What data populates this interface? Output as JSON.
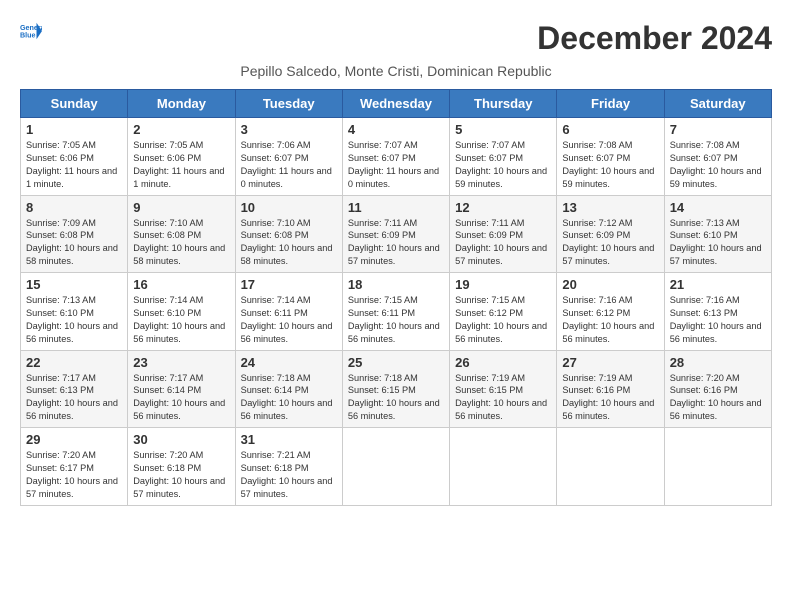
{
  "header": {
    "logo_line1": "General",
    "logo_line2": "Blue",
    "title": "December 2024",
    "subtitle": "Pepillo Salcedo, Monte Cristi, Dominican Republic"
  },
  "days_of_week": [
    "Sunday",
    "Monday",
    "Tuesday",
    "Wednesday",
    "Thursday",
    "Friday",
    "Saturday"
  ],
  "weeks": [
    [
      {
        "day": "1",
        "sunrise": "Sunrise: 7:05 AM",
        "sunset": "Sunset: 6:06 PM",
        "daylight": "Daylight: 11 hours and 1 minute."
      },
      {
        "day": "2",
        "sunrise": "Sunrise: 7:05 AM",
        "sunset": "Sunset: 6:06 PM",
        "daylight": "Daylight: 11 hours and 1 minute."
      },
      {
        "day": "3",
        "sunrise": "Sunrise: 7:06 AM",
        "sunset": "Sunset: 6:07 PM",
        "daylight": "Daylight: 11 hours and 0 minutes."
      },
      {
        "day": "4",
        "sunrise": "Sunrise: 7:07 AM",
        "sunset": "Sunset: 6:07 PM",
        "daylight": "Daylight: 11 hours and 0 minutes."
      },
      {
        "day": "5",
        "sunrise": "Sunrise: 7:07 AM",
        "sunset": "Sunset: 6:07 PM",
        "daylight": "Daylight: 10 hours and 59 minutes."
      },
      {
        "day": "6",
        "sunrise": "Sunrise: 7:08 AM",
        "sunset": "Sunset: 6:07 PM",
        "daylight": "Daylight: 10 hours and 59 minutes."
      },
      {
        "day": "7",
        "sunrise": "Sunrise: 7:08 AM",
        "sunset": "Sunset: 6:07 PM",
        "daylight": "Daylight: 10 hours and 59 minutes."
      }
    ],
    [
      {
        "day": "8",
        "sunrise": "Sunrise: 7:09 AM",
        "sunset": "Sunset: 6:08 PM",
        "daylight": "Daylight: 10 hours and 58 minutes."
      },
      {
        "day": "9",
        "sunrise": "Sunrise: 7:10 AM",
        "sunset": "Sunset: 6:08 PM",
        "daylight": "Daylight: 10 hours and 58 minutes."
      },
      {
        "day": "10",
        "sunrise": "Sunrise: 7:10 AM",
        "sunset": "Sunset: 6:08 PM",
        "daylight": "Daylight: 10 hours and 58 minutes."
      },
      {
        "day": "11",
        "sunrise": "Sunrise: 7:11 AM",
        "sunset": "Sunset: 6:09 PM",
        "daylight": "Daylight: 10 hours and 57 minutes."
      },
      {
        "day": "12",
        "sunrise": "Sunrise: 7:11 AM",
        "sunset": "Sunset: 6:09 PM",
        "daylight": "Daylight: 10 hours and 57 minutes."
      },
      {
        "day": "13",
        "sunrise": "Sunrise: 7:12 AM",
        "sunset": "Sunset: 6:09 PM",
        "daylight": "Daylight: 10 hours and 57 minutes."
      },
      {
        "day": "14",
        "sunrise": "Sunrise: 7:13 AM",
        "sunset": "Sunset: 6:10 PM",
        "daylight": "Daylight: 10 hours and 57 minutes."
      }
    ],
    [
      {
        "day": "15",
        "sunrise": "Sunrise: 7:13 AM",
        "sunset": "Sunset: 6:10 PM",
        "daylight": "Daylight: 10 hours and 56 minutes."
      },
      {
        "day": "16",
        "sunrise": "Sunrise: 7:14 AM",
        "sunset": "Sunset: 6:10 PM",
        "daylight": "Daylight: 10 hours and 56 minutes."
      },
      {
        "day": "17",
        "sunrise": "Sunrise: 7:14 AM",
        "sunset": "Sunset: 6:11 PM",
        "daylight": "Daylight: 10 hours and 56 minutes."
      },
      {
        "day": "18",
        "sunrise": "Sunrise: 7:15 AM",
        "sunset": "Sunset: 6:11 PM",
        "daylight": "Daylight: 10 hours and 56 minutes."
      },
      {
        "day": "19",
        "sunrise": "Sunrise: 7:15 AM",
        "sunset": "Sunset: 6:12 PM",
        "daylight": "Daylight: 10 hours and 56 minutes."
      },
      {
        "day": "20",
        "sunrise": "Sunrise: 7:16 AM",
        "sunset": "Sunset: 6:12 PM",
        "daylight": "Daylight: 10 hours and 56 minutes."
      },
      {
        "day": "21",
        "sunrise": "Sunrise: 7:16 AM",
        "sunset": "Sunset: 6:13 PM",
        "daylight": "Daylight: 10 hours and 56 minutes."
      }
    ],
    [
      {
        "day": "22",
        "sunrise": "Sunrise: 7:17 AM",
        "sunset": "Sunset: 6:13 PM",
        "daylight": "Daylight: 10 hours and 56 minutes."
      },
      {
        "day": "23",
        "sunrise": "Sunrise: 7:17 AM",
        "sunset": "Sunset: 6:14 PM",
        "daylight": "Daylight: 10 hours and 56 minutes."
      },
      {
        "day": "24",
        "sunrise": "Sunrise: 7:18 AM",
        "sunset": "Sunset: 6:14 PM",
        "daylight": "Daylight: 10 hours and 56 minutes."
      },
      {
        "day": "25",
        "sunrise": "Sunrise: 7:18 AM",
        "sunset": "Sunset: 6:15 PM",
        "daylight": "Daylight: 10 hours and 56 minutes."
      },
      {
        "day": "26",
        "sunrise": "Sunrise: 7:19 AM",
        "sunset": "Sunset: 6:15 PM",
        "daylight": "Daylight: 10 hours and 56 minutes."
      },
      {
        "day": "27",
        "sunrise": "Sunrise: 7:19 AM",
        "sunset": "Sunset: 6:16 PM",
        "daylight": "Daylight: 10 hours and 56 minutes."
      },
      {
        "day": "28",
        "sunrise": "Sunrise: 7:20 AM",
        "sunset": "Sunset: 6:16 PM",
        "daylight": "Daylight: 10 hours and 56 minutes."
      }
    ],
    [
      {
        "day": "29",
        "sunrise": "Sunrise: 7:20 AM",
        "sunset": "Sunset: 6:17 PM",
        "daylight": "Daylight: 10 hours and 57 minutes."
      },
      {
        "day": "30",
        "sunrise": "Sunrise: 7:20 AM",
        "sunset": "Sunset: 6:18 PM",
        "daylight": "Daylight: 10 hours and 57 minutes."
      },
      {
        "day": "31",
        "sunrise": "Sunrise: 7:21 AM",
        "sunset": "Sunset: 6:18 PM",
        "daylight": "Daylight: 10 hours and 57 minutes."
      },
      null,
      null,
      null,
      null
    ]
  ]
}
